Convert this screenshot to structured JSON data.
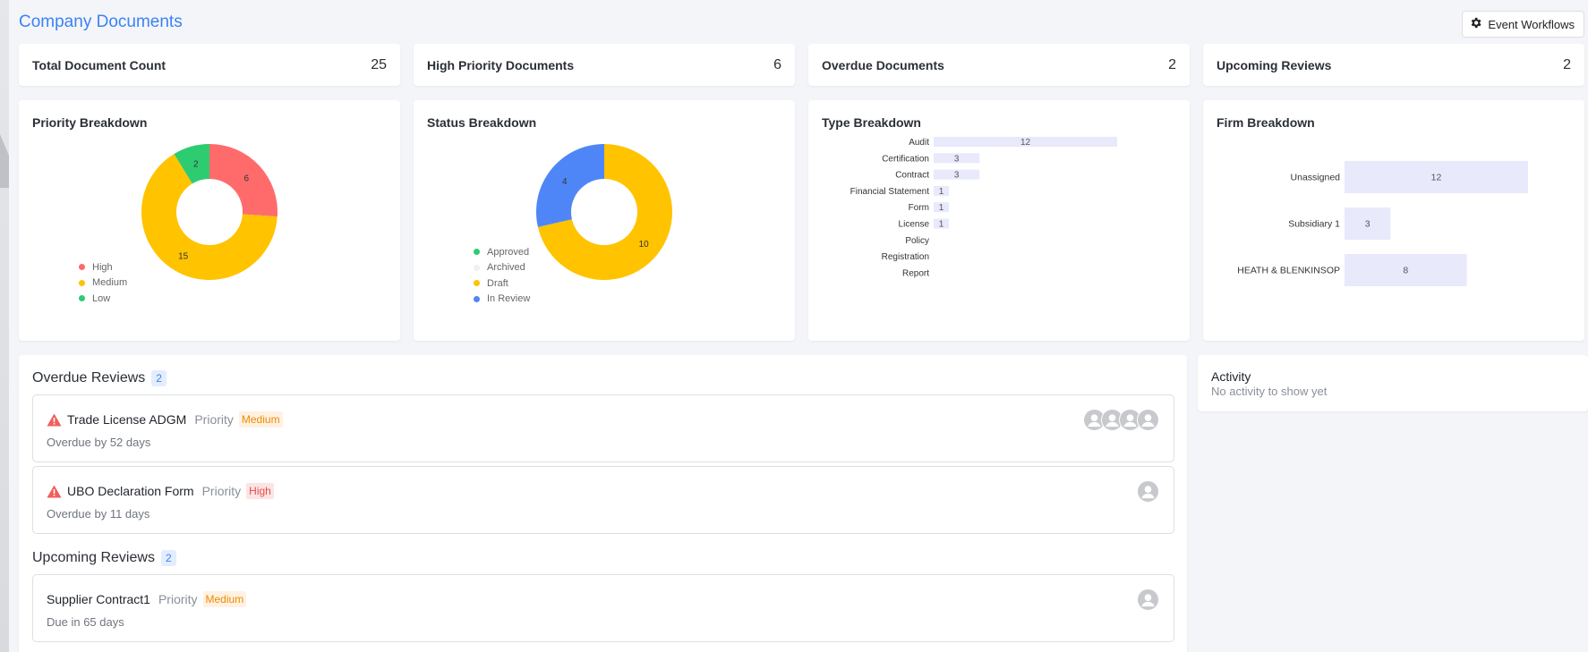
{
  "page": {
    "title": "Company Documents",
    "workflow_button": "Event Workflows"
  },
  "stats": [
    {
      "label": "Total Document Count",
      "value": "25"
    },
    {
      "label": "High Priority Documents",
      "value": "6"
    },
    {
      "label": "Overdue Documents",
      "value": "2"
    },
    {
      "label": "Upcoming Reviews",
      "value": "2"
    }
  ],
  "colors": {
    "accent": "#3b82f6",
    "high": "#ff6b6b",
    "medium": "#ffc300",
    "low": "#2ecc71",
    "archived": "#f0f0f0",
    "bar": "#e8e9fb"
  },
  "chart_data": [
    {
      "type": "pie",
      "title": "Priority Breakdown",
      "labels": [
        "High",
        "Medium",
        "Low"
      ],
      "values": [
        6,
        15,
        2
      ],
      "colors": [
        "#ff6b6b",
        "#ffc300",
        "#2ecc71"
      ],
      "legend": "bottom-left"
    },
    {
      "type": "pie",
      "title": "Status Breakdown",
      "labels": [
        "Approved",
        "Archived",
        "Draft",
        "In Review"
      ],
      "values": [
        0,
        0,
        10,
        4
      ],
      "colors": [
        "#2ecc71",
        "#f0f0f0",
        "#ffc300",
        "#4f86f7"
      ],
      "legend": "bottom-left"
    },
    {
      "type": "bar",
      "orientation": "horizontal",
      "title": "Type Breakdown",
      "categories": [
        "Audit",
        "Certification",
        "Contract",
        "Financial Statement",
        "Form",
        "License",
        "Policy",
        "Registration",
        "Report"
      ],
      "values": [
        12,
        3,
        3,
        1,
        1,
        1,
        0,
        0,
        0
      ],
      "color": "#e8e9fb"
    },
    {
      "type": "bar",
      "orientation": "horizontal",
      "title": "Firm Breakdown",
      "categories": [
        "Unassigned",
        "Subsidiary 1",
        "HEATH & BLENKINSOP"
      ],
      "values": [
        12,
        3,
        8
      ],
      "color": "#e8e9fb"
    }
  ],
  "overdue": {
    "title": "Overdue Reviews",
    "count": "2",
    "items": [
      {
        "name": "Trade License ADGM",
        "priority_label": "Priority",
        "priority": "Medium",
        "level": "medium",
        "sub": "Overdue by 52 days",
        "avatars": 4
      },
      {
        "name": "UBO Declaration Form",
        "priority_label": "Priority",
        "priority": "High",
        "level": "high",
        "sub": "Overdue by 11 days",
        "avatars": 1
      }
    ]
  },
  "upcoming": {
    "title": "Upcoming Reviews",
    "count": "2",
    "items": [
      {
        "name": "Supplier Contract1",
        "priority_label": "Priority",
        "priority": "Medium",
        "level": "medium",
        "sub": "Due in 65 days",
        "avatars": 1
      }
    ]
  },
  "activity": {
    "title": "Activity",
    "empty": "No activity to show yet"
  }
}
